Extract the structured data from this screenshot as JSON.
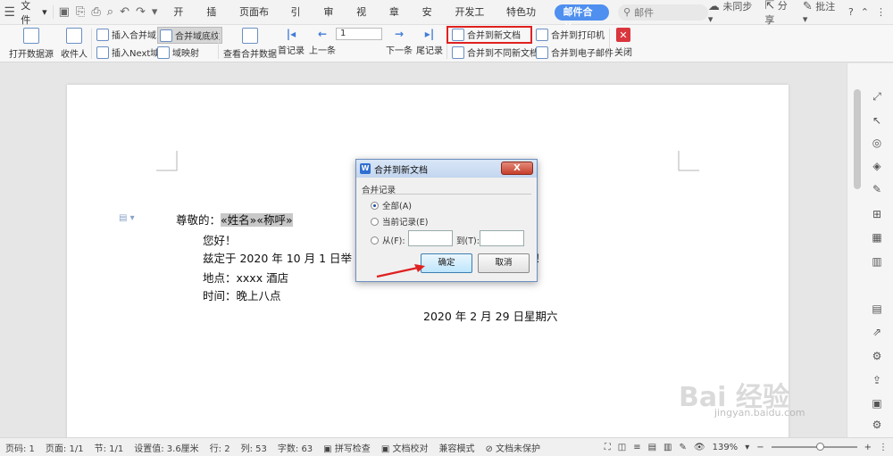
{
  "menu": {
    "file_label": "文件",
    "tabs": [
      "开始",
      "插入",
      "页面布局",
      "引用",
      "审阅",
      "视图",
      "章节",
      "安全",
      "开发工具",
      "特色功能",
      "邮件合并"
    ],
    "active_tab": "邮件合并",
    "search_placeholder": "邮件",
    "sync": "未同步",
    "share": "分享",
    "comment": "批注"
  },
  "ribbon": {
    "open_source": "打开数据源",
    "recipient": "收件人",
    "insert_field": "插入合并域",
    "highlight_field": "合并域底纹",
    "insert_next": "插入Next域",
    "field_map": "域映射",
    "view_data": "查看合并数据",
    "first": "首记录",
    "prev": "上一条",
    "record_number": "1",
    "next": "下一条",
    "last": "尾记录",
    "merge_new_doc": "合并到新文档",
    "merge_diff_docs": "合并到不同新文档",
    "merge_printer": "合并到打印机",
    "merge_email": "合并到电子邮件",
    "close": "关闭"
  },
  "document": {
    "greeting_prefix": "尊敬的：",
    "greeting_field": "«姓名»«称呼»",
    "hello": "您好！",
    "line3": "兹定于 2020 年 10 月 1 日举",
    "line3_tail": "！",
    "place": "地点：xxxx 酒店",
    "time": "时间：晚上八点",
    "date": "2020 年 2 月 29 日星期六"
  },
  "dialog": {
    "title": "合并到新文档",
    "close": "X",
    "group": "合并记录",
    "opt_all": "全部(A)",
    "opt_current": "当前记录(E)",
    "opt_from": "从(F):",
    "opt_to": "到(T):",
    "from_value": "",
    "to_value": "",
    "ok": "确定",
    "cancel": "取消"
  },
  "status": {
    "page": "页码: 1",
    "pages": "页面: 1/1",
    "section": "节: 1/1",
    "setting": "设置值: 3.6厘米",
    "row": "行: 2",
    "col": "列: 53",
    "words": "字数: 63",
    "spell": "拼写检查",
    "doc_check": "文档校对",
    "compat": "兼容模式",
    "protect": "文档未保护",
    "zoom": "139%"
  },
  "watermark": {
    "main": "Bai 经验",
    "sub": "jingyan.baidu.com"
  },
  "colors": {
    "accent": "#4e8ff0",
    "highlight_red": "#e02020",
    "field_bg": "#c8c8c8"
  }
}
